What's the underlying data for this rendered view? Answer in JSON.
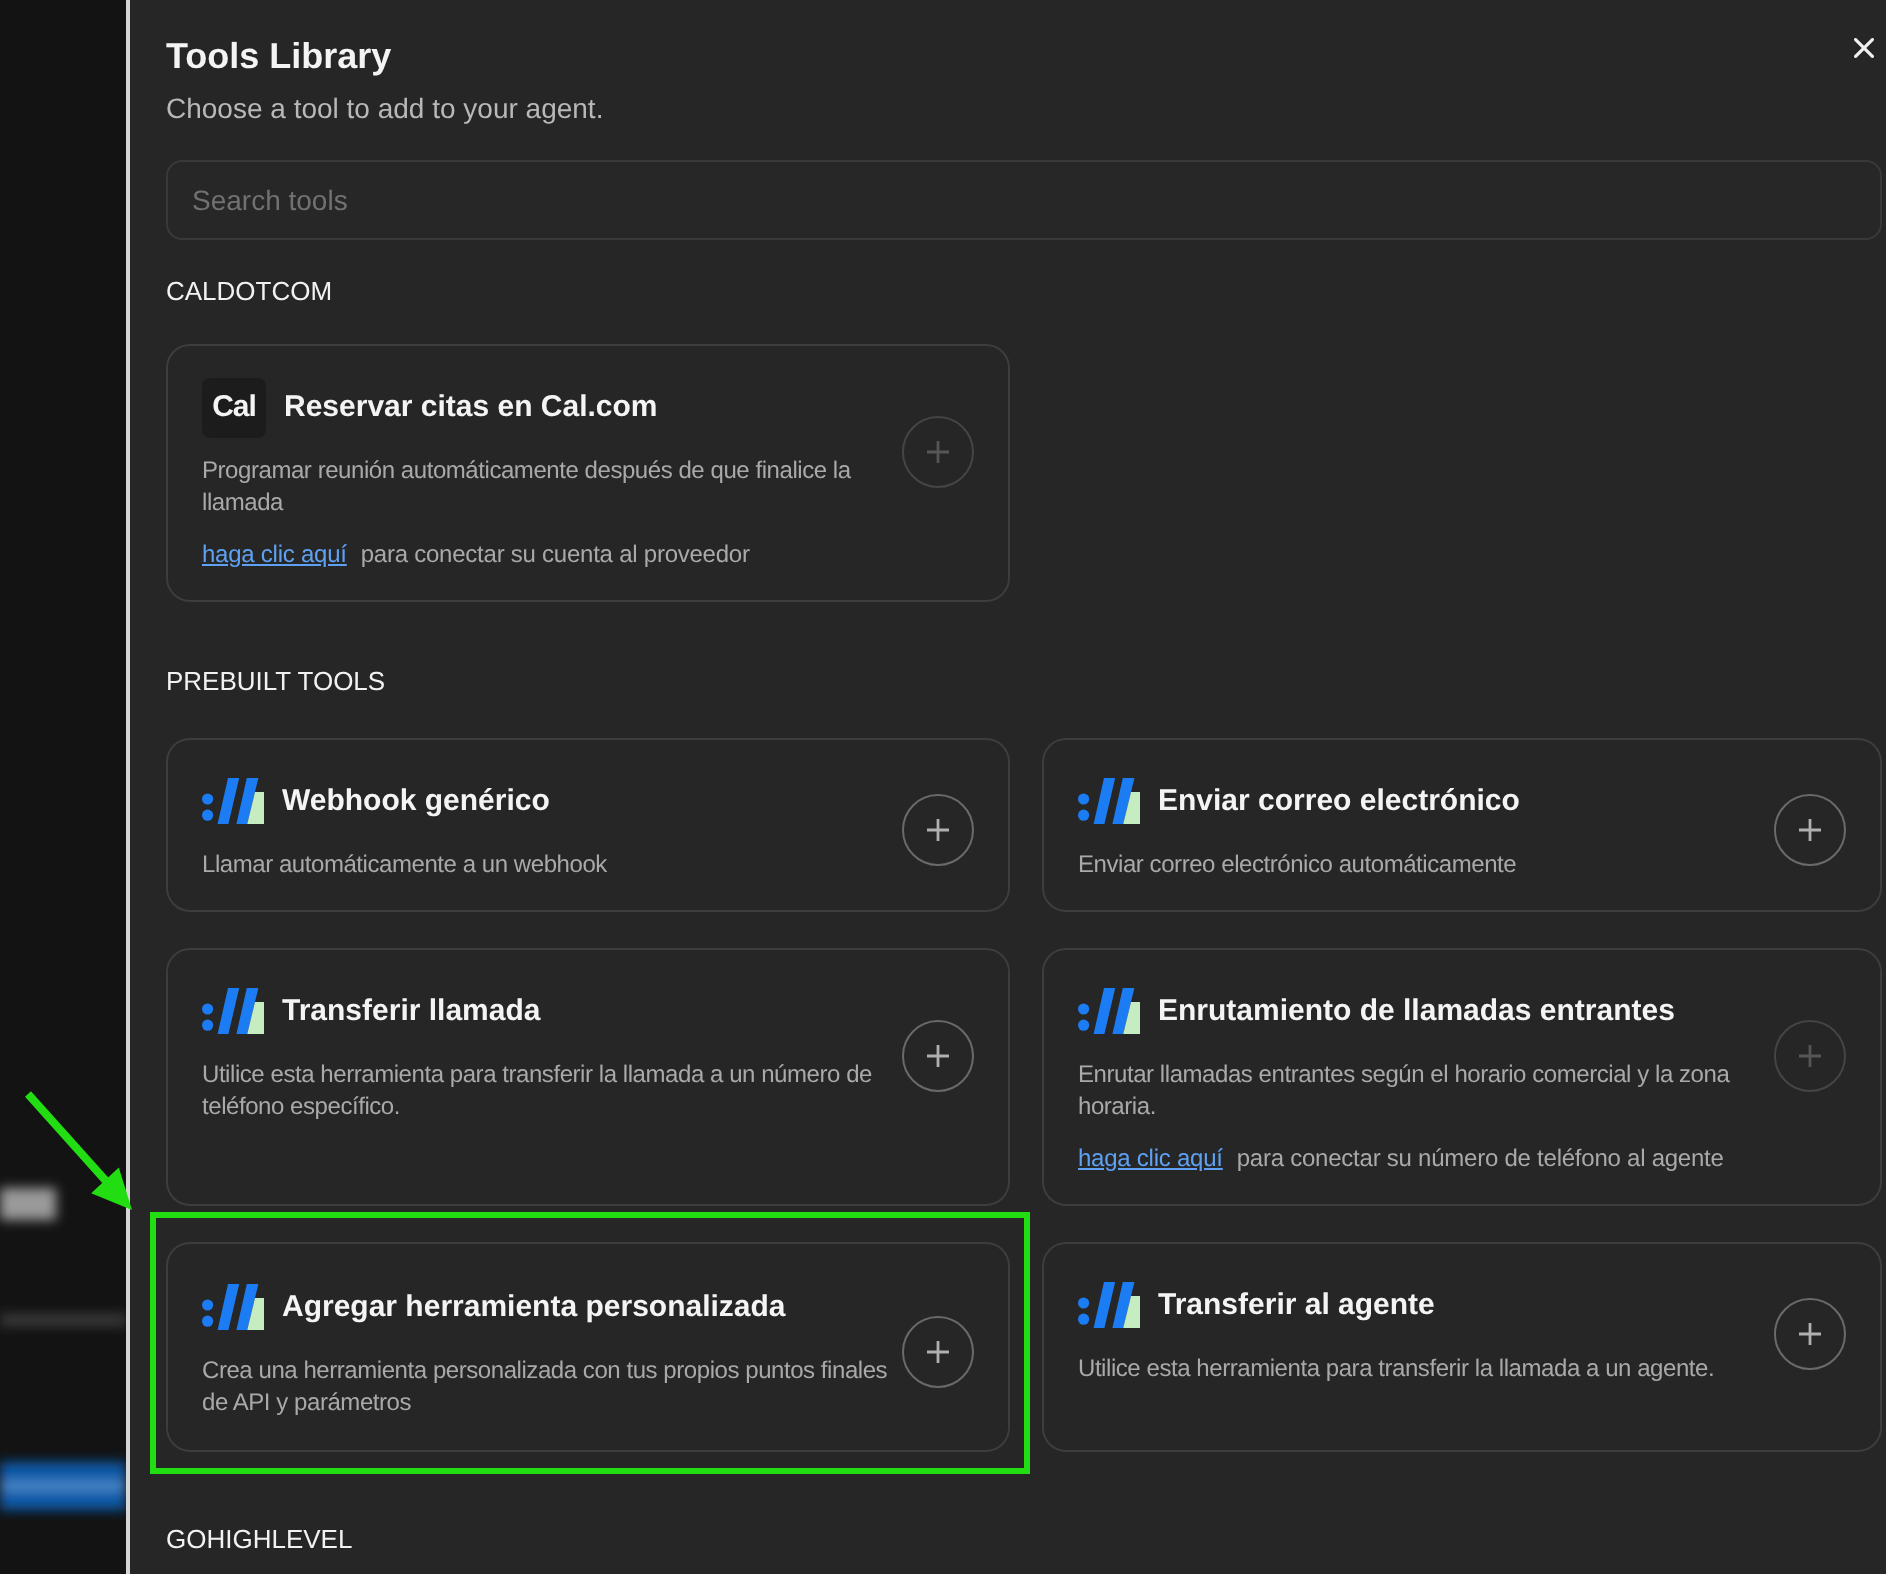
{
  "panel": {
    "title": "Tools Library",
    "subtitle": "Choose a tool to add to your agent.",
    "search": {
      "placeholder": "Search tools"
    }
  },
  "sections": [
    {
      "label": "CALDOTCOM",
      "tools": [
        {
          "logo": {
            "kind": "wordmark",
            "text": "Cal"
          },
          "title": "Reservar citas en Cal.com",
          "description": "Programar reunión automáticamente después de que finalice la llamada",
          "link": {
            "text": "haga clic aquí",
            "note": "para conectar su cuenta al proveedor"
          },
          "add": {
            "disabled": true
          },
          "highlighted": false
        }
      ]
    },
    {
      "label": "PREBUILT TOOLS",
      "tools": [
        {
          "logo": {
            "kind": "mark"
          },
          "title": "Webhook genérico",
          "description": "Llamar automáticamente a un webhook",
          "add": {
            "disabled": false
          },
          "highlighted": false
        },
        {
          "logo": {
            "kind": "mark"
          },
          "title": "Enviar correo electrónico",
          "description": "Enviar correo electrónico automáticamente",
          "add": {
            "disabled": false
          },
          "highlighted": false
        },
        {
          "logo": {
            "kind": "mark"
          },
          "title": "Transferir llamada",
          "description": "Utilice esta herramienta para transferir la llamada a un número de teléfono específico.",
          "add": {
            "disabled": false
          },
          "highlighted": false
        },
        {
          "logo": {
            "kind": "mark"
          },
          "title": "Enrutamiento de llamadas entrantes",
          "description": "Enrutar llamadas entrantes según el horario comercial y la zona horaria.",
          "link": {
            "text": "haga clic aquí",
            "note": "para conectar su número de teléfono al agente"
          },
          "add": {
            "disabled": true
          },
          "highlighted": false
        },
        {
          "logo": {
            "kind": "mark"
          },
          "title": "Agregar herramienta personalizada",
          "description": "Crea una herramienta personalizada con tus propios puntos finales de API y parámetros",
          "add": {
            "disabled": false
          },
          "highlighted": true
        },
        {
          "logo": {
            "kind": "mark"
          },
          "title": "Transferir al agente",
          "description": "Utilice esta herramienta para transferir la llamada a un agente.",
          "add": {
            "disabled": false
          },
          "highlighted": false
        }
      ]
    },
    {
      "label": "GOHIGHLEVEL"
    }
  ]
}
